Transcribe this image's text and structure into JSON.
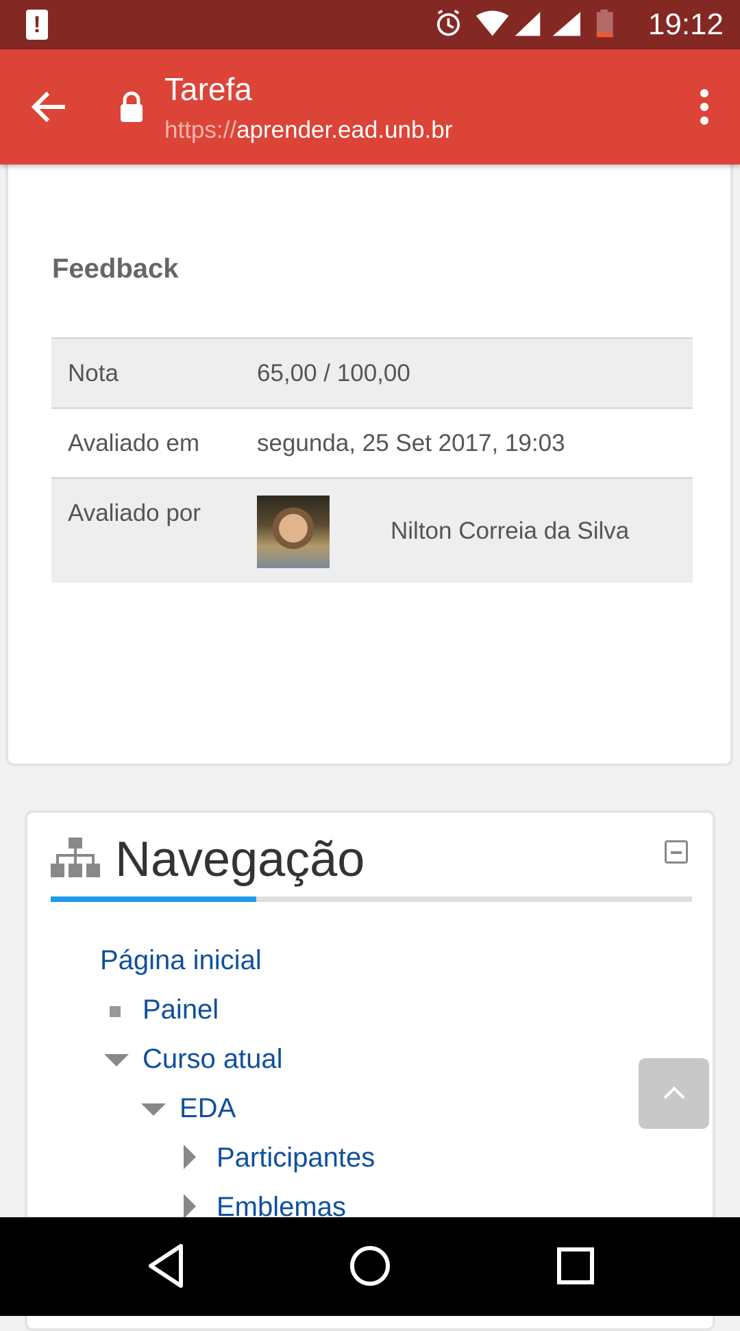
{
  "status_bar": {
    "time": "19:12",
    "icons": [
      "alert-icon",
      "alarm-icon",
      "wifi-icon",
      "signal-icon",
      "signal-icon",
      "battery-icon"
    ],
    "bg_color": "#842824"
  },
  "app_bar": {
    "title": "Tarefa",
    "url_scheme": "https://",
    "url_host": "aprender.ead.unb.br",
    "color": "#db4437"
  },
  "feedback": {
    "heading": "Feedback",
    "rows": [
      {
        "label": "Nota",
        "value": "65,00 / 100,00"
      },
      {
        "label": "Avaliado em",
        "value": "segunda, 25 Set 2017, 19:03"
      },
      {
        "label": "Avaliado por",
        "value": "Nilton Correia da Silva"
      }
    ]
  },
  "navigation": {
    "title": "Navegação",
    "items": [
      {
        "label": "Página inicial"
      },
      {
        "label": "Painel"
      },
      {
        "label": "Curso atual"
      },
      {
        "label": "EDA"
      },
      {
        "label": "Participantes"
      },
      {
        "label": "Emblemas"
      }
    ],
    "accent_color": "#1e9be9",
    "link_color": "#0f4f9e"
  }
}
